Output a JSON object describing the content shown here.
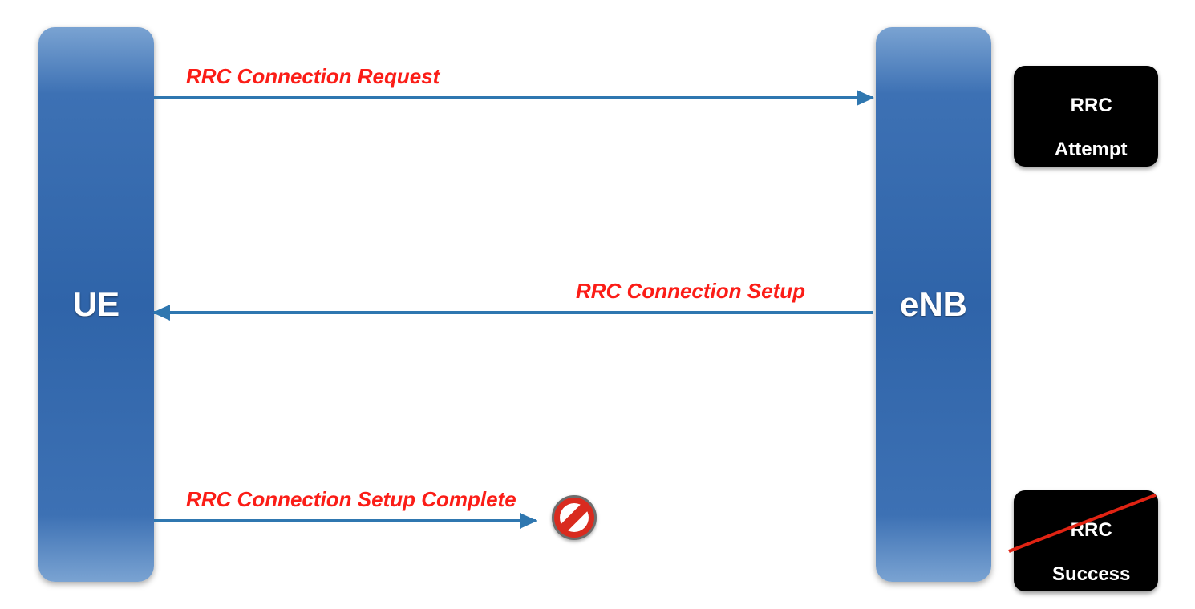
{
  "nodes": {
    "ue": {
      "label": "UE"
    },
    "enb": {
      "label": "eNB"
    }
  },
  "messages": {
    "request": {
      "label": "RRC Connection Request"
    },
    "setup": {
      "label": "RRC Connection Setup"
    },
    "setup_complete": {
      "label": "RRC Connection Setup Complete"
    }
  },
  "badges": {
    "attempt": {
      "line1": "RRC",
      "line2": "Attempt"
    },
    "success": {
      "line1": "RRC",
      "line2": "Success"
    }
  },
  "colors": {
    "node_gradient_light": "#7aa3d2",
    "node_gradient_dark": "#2f64a9",
    "arrow": "#2f77b0",
    "label": "#fb1d17",
    "badge_bg": "#000000",
    "no_entry": "#d92b1f"
  }
}
